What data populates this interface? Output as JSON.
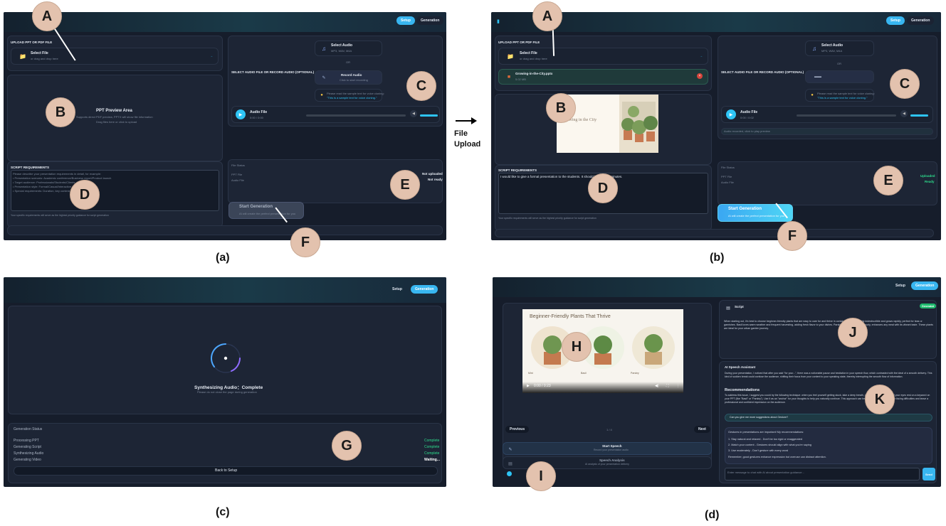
{
  "captions": {
    "a": "(a)",
    "b": "(b)",
    "c": "(c)",
    "d": "(d)"
  },
  "arrow_label": "File Upload",
  "markers": {
    "A": "A",
    "B": "B",
    "C": "C",
    "D": "D",
    "E": "E",
    "F": "F",
    "G": "G",
    "H": "H",
    "I": "I",
    "J": "J",
    "K": "K"
  },
  "nav": {
    "setup": "Setup",
    "generation": "Generation"
  },
  "upload": {
    "title": "UPLOAD PPT OR PDF FILE",
    "select_file": "Select File",
    "select_hint": "or drag and drop here",
    "uploaded_name": "Growing-in-the-City.pptx",
    "uploaded_size": "5.02 MB"
  },
  "preview": {
    "title": "PPT Preview Area",
    "desc": "Supports direct PDF preview, PPTX will show file information",
    "hint": "Drag files here or click to upload",
    "slide_title": "Growing in the City"
  },
  "audio": {
    "section_title": "SELECT AUDIO FILE OR RECORD AUDIO (OPTIONAL)",
    "select_audio": "Select Audio",
    "formats": "MP3, WAV, M4A",
    "or": "OR",
    "record": "Record Audio",
    "record_hint": "Click to start recording",
    "sample_note": "Please read the sample text for voice cloning:",
    "sample_text": "\"This is a sample text for voice cloning.\"",
    "audio_file": "Audio File",
    "time_a": "0:00 / 0:00",
    "time_b": "0:00 / 0:02",
    "recorded_note": "Audio recorded, click to play preview"
  },
  "script": {
    "title": "SCRIPT REQUIREMENTS",
    "placeholder": "Please describe your presentation requirements in detail, for example:\n• Presentation scenario: Academic conference/Business report/Product launch\n• Target audience: Professionals/Students/Clients\n• Presentation style: Formal/Casual/Interactive\n• Special requirements: Duration, key content, etc.",
    "value": "I would like to give a formal presentation to the students. It should be about 2 minutes.",
    "footnote": "Your specific requirements will serve as the highest priority guidance for script generation"
  },
  "status": {
    "title": "File Status",
    "ppt_label": "PPT File",
    "audio_label": "Audio File",
    "ppt_a": "Not uploaded",
    "audio_a": "Not ready",
    "ppt_b": "Uploaded",
    "audio_b": "Ready"
  },
  "generate": {
    "label": "Start Generation",
    "sub": "AI will create the perfect presentation for you"
  },
  "progress": {
    "title": "Synthesizing Audio：Complete",
    "sub": "Please do not close the page during generation",
    "status_title": "Generation Status",
    "rows": [
      {
        "label": "Processing PPT",
        "value": "Complete"
      },
      {
        "label": "Generating Script",
        "value": "Complete"
      },
      {
        "label": "Synthesizing Audio",
        "value": "Complete"
      },
      {
        "label": "Generating Video",
        "value": "Waiting..."
      }
    ],
    "back": "Back to Setup"
  },
  "result": {
    "slide_title": "Beginner-Friendly Plants That Thrive",
    "plant_labels": [
      "Mint",
      "Basil",
      "Parsley"
    ],
    "video_time": "0:00 / 0:23",
    "prev": "Previous",
    "next": "Next",
    "page": "1 / 4",
    "start_speech": "Start Speech",
    "start_speech_sub": "Record your presentation audio",
    "speech_analysis": "Speech Analysis",
    "speech_analysis_sub": "AI analysis of your presentation delivery",
    "script_label": "Script",
    "script_badge": "Generated",
    "script_text": "When starting out, it's best to choose beginner-friendly plants that are easy to care for and thrive in containers. Mint is nearly indestructible and grows rapidly, perfect for teas or garnishes. Basil loves warm weather and frequent harvesting, adding fresh flavor to your dishes. Parsley, whether flat leaf or curly, enhances any meal with its vibrant taste. These plants are ideal for your urban garden journey.",
    "assistant_title": "AI Speech Assistant",
    "assistant_text": "During your presentation, I noticed that after you said \"for your...\", there was a noticeable pause and hesitation in your speech flow, which contrasted with the ideal of a smooth delivery. This kind of sudden break could confuse the audience, shifting their focus from your content to your speaking state, thereby interrupting the smooth flow of information.",
    "rec_title": "Recommendations",
    "rec_text": "To address this issue, I suggest you could try the following technique: when you feel yourself getting stuck, take a deep breath, give a gentle break, and let your eyes rest on a keyword on your PPT (like \"Basil\" or \"Parsley\"). Use it as an \"anchor\" for your thoughts to help you naturally continue. This approach can help you stay composed when facing difficulties and leave a professional and confident impression on the audience.",
    "user_q": "Can you give me more suggestions about Gesture?",
    "reply_intro": "Gestures in presentations are important! My recommendations:",
    "reply_items": [
      "1. Stay natural and relaxed - Don't be too rigid or exaggerated",
      "2. Match your content - Gestures should align with what you're saying",
      "3. Use moderately - Don't gesture with every word"
    ],
    "reply_outro": "Remember, good gestures enhance expression but overuse can distract attention.",
    "input_placeholder": "Enter message to chat with AI about presentation guidance...",
    "send": "Send"
  }
}
